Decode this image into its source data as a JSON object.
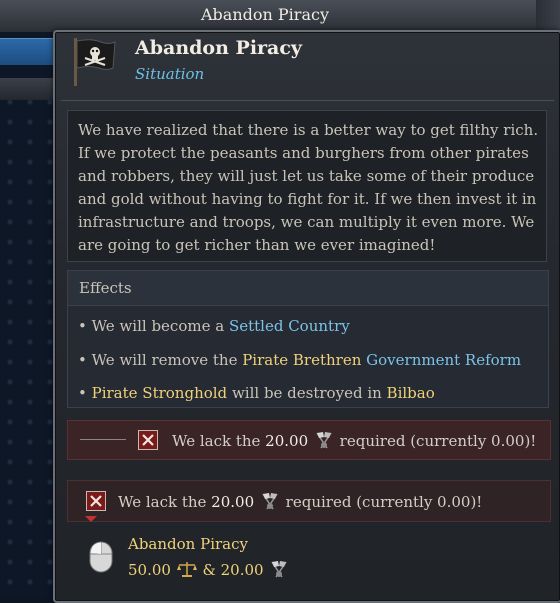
{
  "background": {
    "window_title": "Abandon Piracy"
  },
  "tooltip": {
    "title": "Abandon Piracy",
    "subtitle": "Situation",
    "description": "We have realized that there is a better way to get filthy rich. If we protect the peasants and burghers from other pirates and robbers, they will just let us take some of their produce and gold without having to fight for it. If we then invest it in infrastructure and troops, we can multiply it even more. We are going to get richer than we ever imagined!",
    "effects": {
      "heading": "Effects",
      "items": [
        {
          "prefix": "• We will become a ",
          "highlight": "Settled Country"
        },
        {
          "prefix": "• We will remove the ",
          "gold": "Pirate Brethren",
          "highlight": "Government Reform"
        },
        {
          "bullet": "• ",
          "gold": "Pirate Stronghold",
          "middle": " will be destroyed in ",
          "gold2": "Bilbao"
        }
      ]
    },
    "requirement_1": {
      "pre": "We lack the ",
      "amount": "20.00",
      "post": " required (currently 0.00)!"
    },
    "requirement_2": {
      "pre": "We lack the ",
      "amount": "20.00",
      "post": " required (currently 0.00)!"
    },
    "action": {
      "label": "Abandon Piracy",
      "cost_ducats": "50.00",
      "separator": " & ",
      "cost_other": "20.00"
    }
  },
  "colors": {
    "accent_blue": "#7cc3e8",
    "accent_gold": "#f0d27a",
    "error_red": "#7a1b1b"
  },
  "icons": [
    "pirate-flag-icon",
    "crossed-flags-icon",
    "mouse-icon",
    "scales-icon",
    "x-checkbox-icon"
  ]
}
